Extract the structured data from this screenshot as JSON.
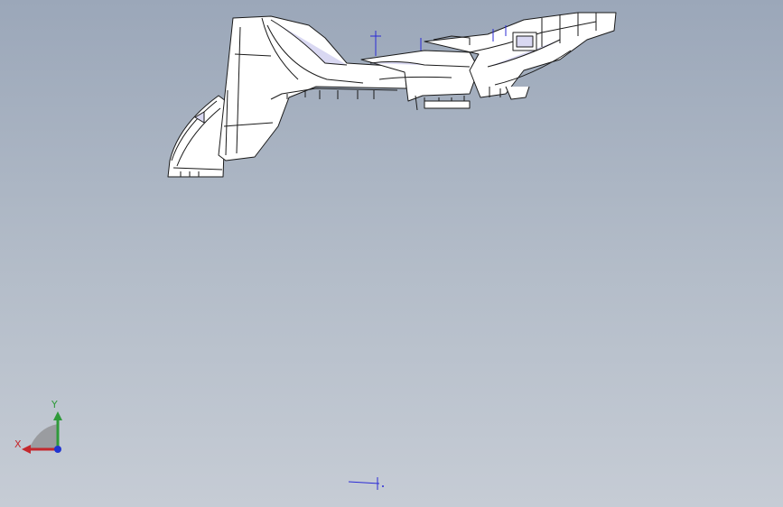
{
  "viewport": {
    "background_top": "#9ba7b9",
    "background_bottom": "#c6ccd5"
  },
  "model": {
    "edge_color": "#1a1a1a",
    "face_color": "#ffffff",
    "shaded_face_color": "#d9d8f2",
    "sketch_color": "#2b2bd6"
  },
  "triad": {
    "x_label": "X",
    "y_label": "Y",
    "x_color": "#c4282d",
    "y_color": "#2f9a3a",
    "z_color": "#2035d0"
  }
}
